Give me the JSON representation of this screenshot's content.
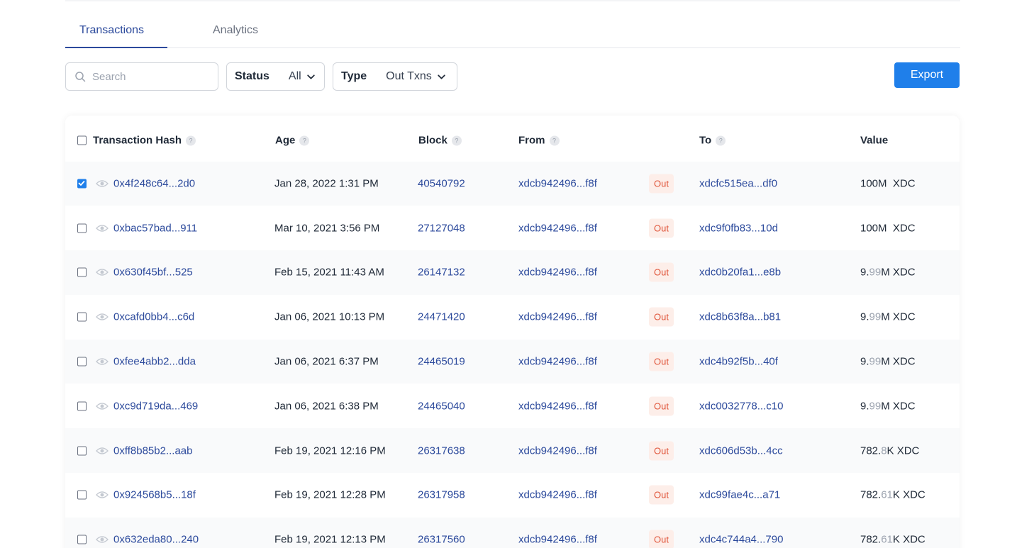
{
  "tabs": [
    {
      "label": "Transactions",
      "active": true
    },
    {
      "label": "Analytics",
      "active": false
    }
  ],
  "search": {
    "placeholder": "Search",
    "value": ""
  },
  "filters": {
    "status": {
      "label": "Status",
      "value": "All"
    },
    "type": {
      "label": "Type",
      "value": "Out Txns"
    }
  },
  "export_label": "Export",
  "colors": {
    "accent": "#1f7fea",
    "link": "#2c4a9c",
    "out_badge_bg": "#fdeee9",
    "out_badge_text": "#e0553a"
  },
  "table": {
    "headers": {
      "hash": "Transaction Hash",
      "age": "Age",
      "block": "Block",
      "from": "From",
      "to": "To",
      "value": "Value",
      "help": "?"
    },
    "rows": [
      {
        "checked": true,
        "hash": "0x4f248c64...2d0",
        "age": "Jan 28, 2022 1:31 PM",
        "block": "40540792",
        "from": "xdcb942496...f8f",
        "direction": "Out",
        "to": "xdcfc515ea...df0",
        "value_main": "100M",
        "value_dec": "",
        "value_unit": "XDC",
        "value_sep": "  "
      },
      {
        "checked": false,
        "hash": "0xbac57bad...911",
        "age": "Mar 10, 2021 3:56 PM",
        "block": "27127048",
        "from": "xdcb942496...f8f",
        "direction": "Out",
        "to": "xdc9f0fb83...10d",
        "value_main": "100M",
        "value_dec": "",
        "value_unit": "XDC",
        "value_sep": "  "
      },
      {
        "checked": false,
        "hash": "0x630f45bf...525",
        "age": "Feb 15, 2021 11:43 AM",
        "block": "26147132",
        "from": "xdcb942496...f8f",
        "direction": "Out",
        "to": "xdc0b20fa1...e8b",
        "value_main": "9.",
        "value_dec": "99",
        "value_unit": "M XDC",
        "value_sep": ""
      },
      {
        "checked": false,
        "hash": "0xcafd0bb4...c6d",
        "age": "Jan 06, 2021 10:13 PM",
        "block": "24471420",
        "from": "xdcb942496...f8f",
        "direction": "Out",
        "to": "xdc8b63f8a...b81",
        "value_main": "9.",
        "value_dec": "99",
        "value_unit": "M XDC",
        "value_sep": ""
      },
      {
        "checked": false,
        "hash": "0xfee4abb2...dda",
        "age": "Jan 06, 2021 6:37 PM",
        "block": "24465019",
        "from": "xdcb942496...f8f",
        "direction": "Out",
        "to": "xdc4b92f5b...40f",
        "value_main": "9.",
        "value_dec": "99",
        "value_unit": "M XDC",
        "value_sep": ""
      },
      {
        "checked": false,
        "hash": "0xc9d719da...469",
        "age": "Jan 06, 2021 6:38 PM",
        "block": "24465040",
        "from": "xdcb942496...f8f",
        "direction": "Out",
        "to": "xdc0032778...c10",
        "value_main": "9.",
        "value_dec": "99",
        "value_unit": "M XDC",
        "value_sep": ""
      },
      {
        "checked": false,
        "hash": "0xff8b85b2...aab",
        "age": "Feb 19, 2021 12:16 PM",
        "block": "26317638",
        "from": "xdcb942496...f8f",
        "direction": "Out",
        "to": "xdc606d53b...4cc",
        "value_main": "782.",
        "value_dec": "8",
        "value_unit": "K XDC",
        "value_sep": ""
      },
      {
        "checked": false,
        "hash": "0x924568b5...18f",
        "age": "Feb 19, 2021 12:28 PM",
        "block": "26317958",
        "from": "xdcb942496...f8f",
        "direction": "Out",
        "to": "xdc99fae4c...a71",
        "value_main": "782.",
        "value_dec": "61",
        "value_unit": "K XDC",
        "value_sep": ""
      },
      {
        "checked": false,
        "hash": "0x632eda80...240",
        "age": "Feb 19, 2021 12:13 PM",
        "block": "26317560",
        "from": "xdcb942496...f8f",
        "direction": "Out",
        "to": "xdc4c744a4...790",
        "value_main": "782.",
        "value_dec": "61",
        "value_unit": "K XDC",
        "value_sep": ""
      }
    ]
  }
}
